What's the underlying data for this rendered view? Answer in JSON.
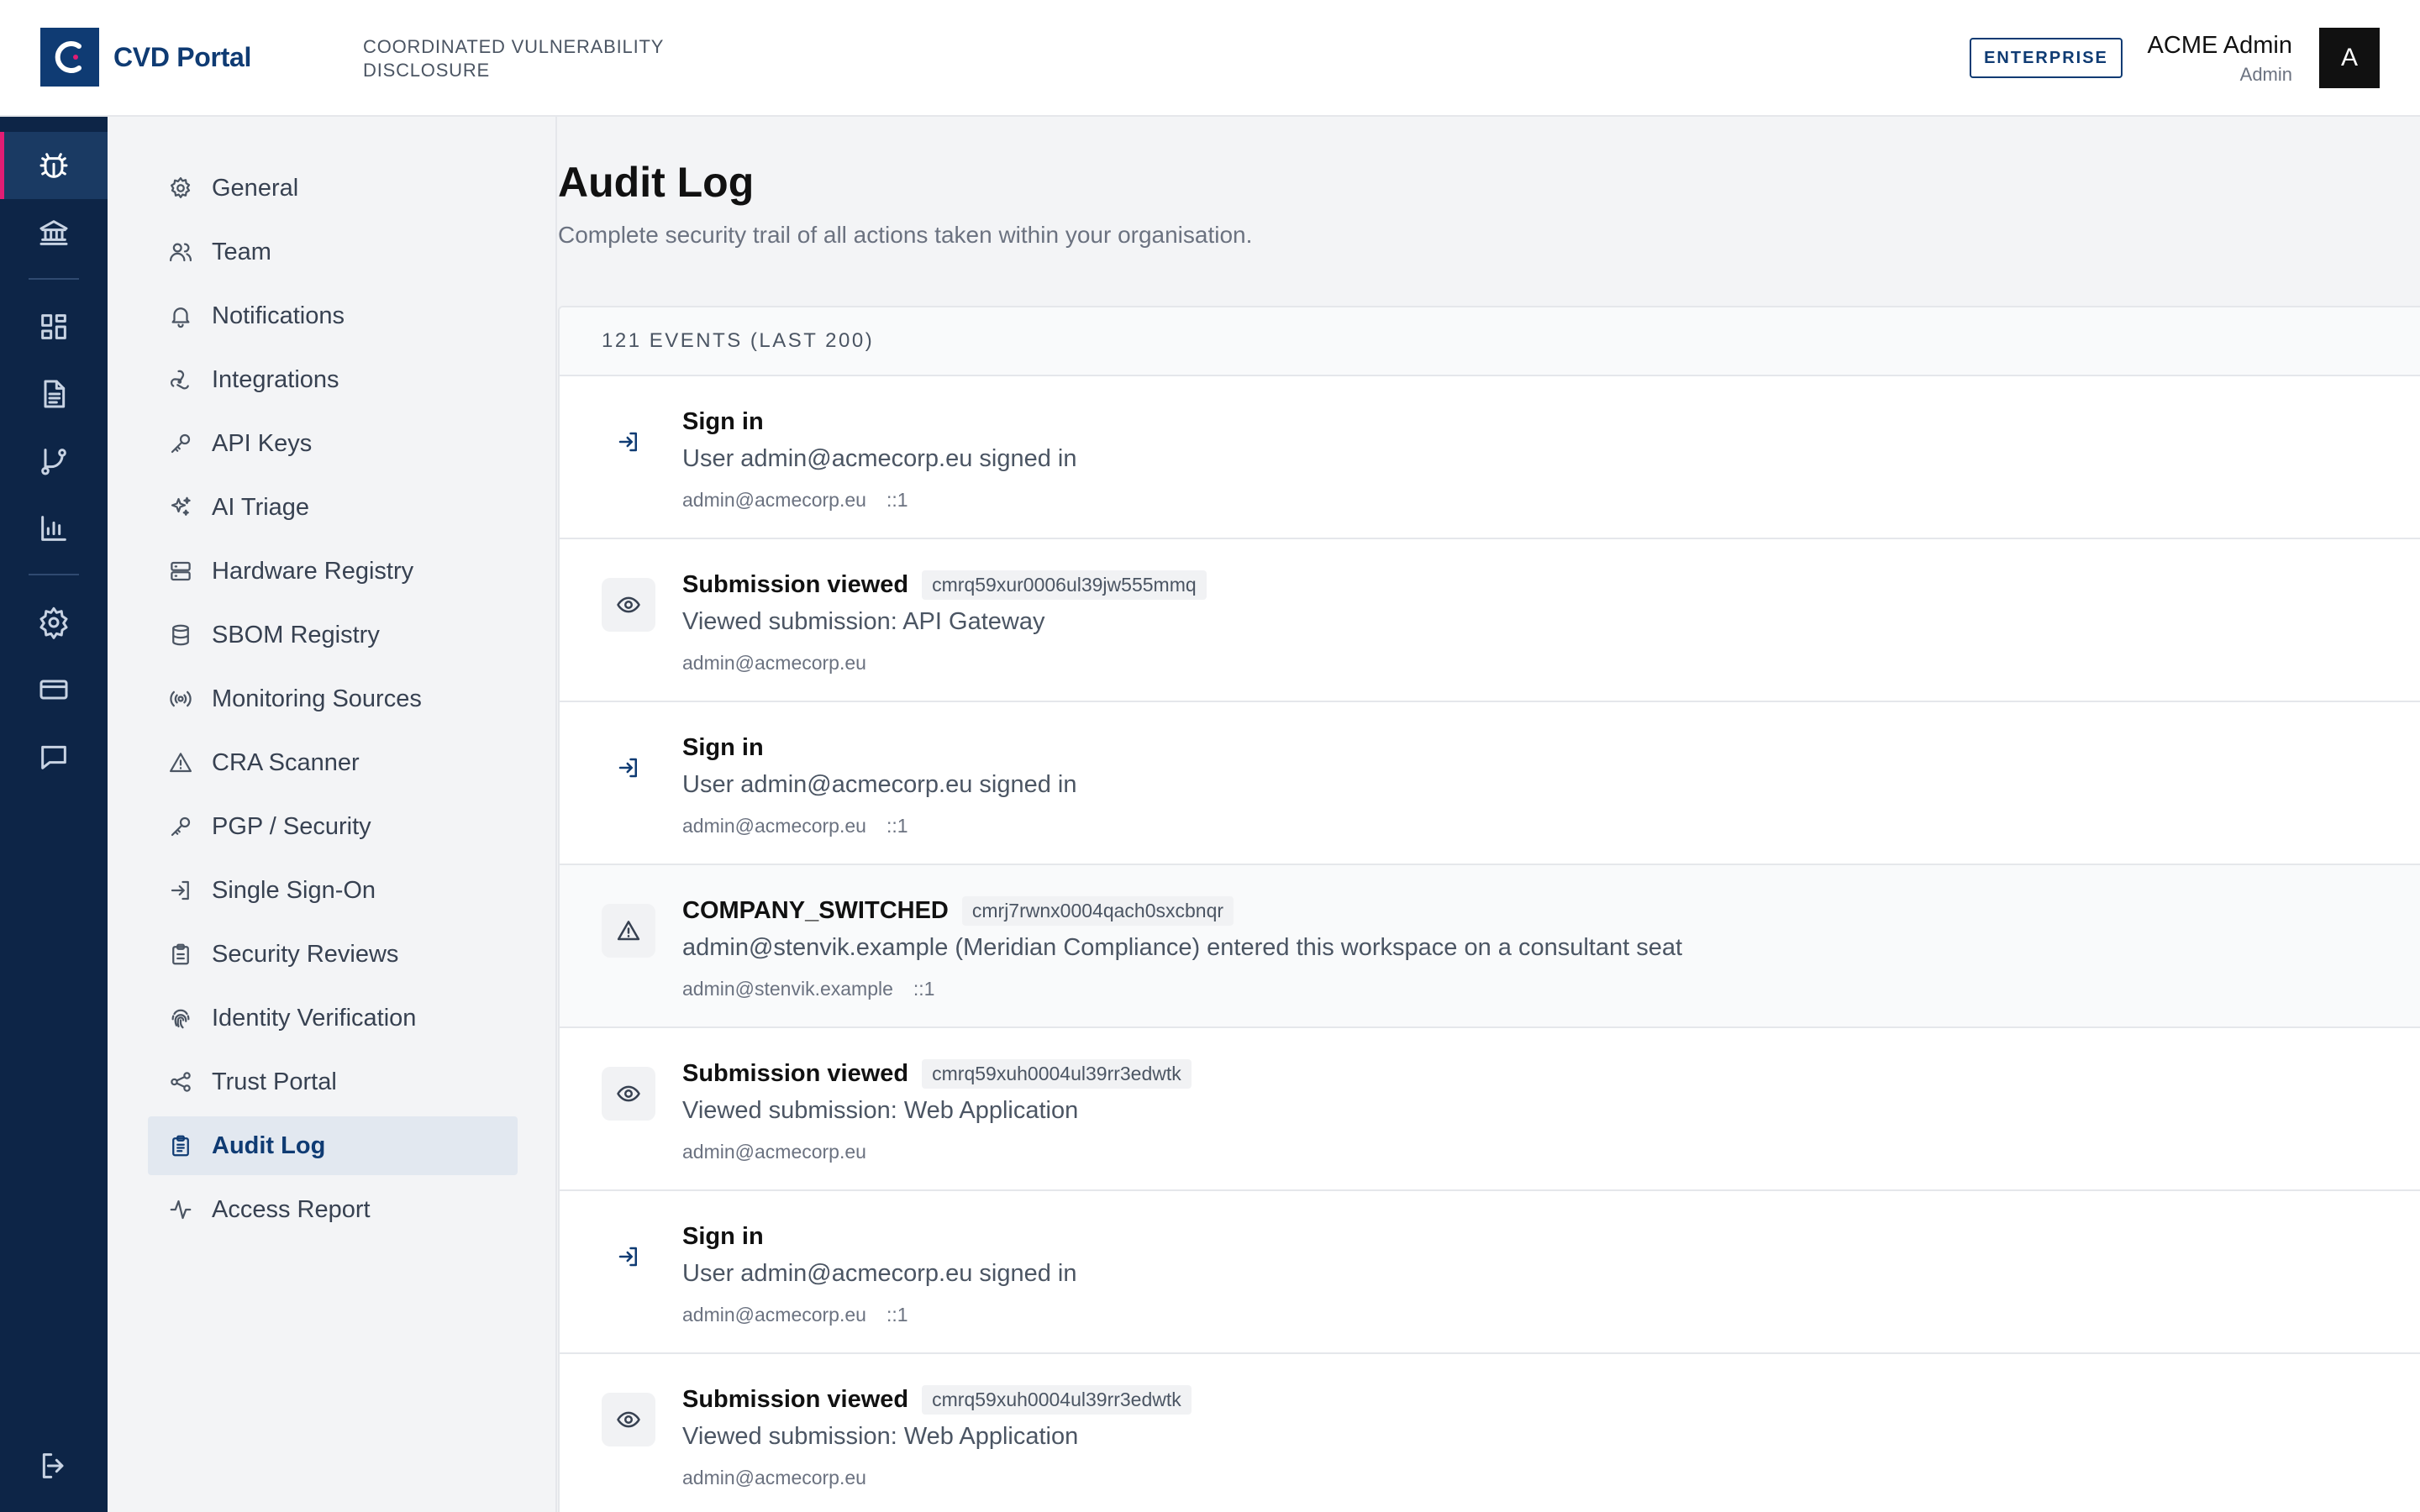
{
  "header": {
    "brand": "CVD Portal",
    "tagline": "COORDINATED VULNERABILITY DISCLOSURE",
    "plan_badge": "ENTERPRISE",
    "user_name": "ACME Admin",
    "user_role": "Admin",
    "avatar_initial": "A"
  },
  "rail": {
    "items": [
      {
        "icon": "bug-icon",
        "active": true
      },
      {
        "icon": "bank-icon"
      },
      {
        "icon": "dashboard-icon"
      },
      {
        "icon": "document-icon"
      },
      {
        "icon": "git-branch-icon"
      },
      {
        "icon": "bar-chart-icon"
      },
      {
        "icon": "gear-icon"
      },
      {
        "icon": "credit-card-icon"
      },
      {
        "icon": "chat-icon"
      },
      {
        "icon": "logout-icon"
      }
    ]
  },
  "settings_nav": {
    "items": [
      {
        "label": "General",
        "icon": "gear-icon"
      },
      {
        "label": "Team",
        "icon": "users-icon"
      },
      {
        "label": "Notifications",
        "icon": "bell-icon"
      },
      {
        "label": "Integrations",
        "icon": "webhook-icon"
      },
      {
        "label": "API Keys",
        "icon": "key-icon"
      },
      {
        "label": "AI Triage",
        "icon": "sparkles-icon"
      },
      {
        "label": "Hardware Registry",
        "icon": "server-icon"
      },
      {
        "label": "SBOM Registry",
        "icon": "database-icon"
      },
      {
        "label": "Monitoring Sources",
        "icon": "radio-icon"
      },
      {
        "label": "CRA Scanner",
        "icon": "warning-icon"
      },
      {
        "label": "PGP / Security",
        "icon": "key-icon"
      },
      {
        "label": "Single Sign-On",
        "icon": "sign-in-icon"
      },
      {
        "label": "Security Reviews",
        "icon": "clipboard-icon"
      },
      {
        "label": "Identity Verification",
        "icon": "fingerprint-icon"
      },
      {
        "label": "Trust Portal",
        "icon": "share-icon"
      },
      {
        "label": "Audit Log",
        "icon": "clipboard-list-icon",
        "active": true
      },
      {
        "label": "Access Report",
        "icon": "activity-icon"
      }
    ]
  },
  "page": {
    "title": "Audit Log",
    "subtitle": "Complete security trail of all actions taken within your organisation."
  },
  "log": {
    "count_label": "121 EVENTS (LAST 200)",
    "events": [
      {
        "type": "signin",
        "title": "Sign in",
        "id": "",
        "description": "User admin@acmecorp.eu signed in",
        "actor": "admin@acmecorp.eu",
        "ip": "::1"
      },
      {
        "type": "view",
        "title": "Submission viewed",
        "id": "cmrq59xur0006ul39jw555mmq",
        "description": "Viewed submission: API Gateway",
        "actor": "admin@acmecorp.eu",
        "ip": ""
      },
      {
        "type": "signin",
        "title": "Sign in",
        "id": "",
        "description": "User admin@acmecorp.eu signed in",
        "actor": "admin@acmecorp.eu",
        "ip": "::1"
      },
      {
        "type": "warning",
        "title": "COMPANY_SWITCHED",
        "id": "cmrj7rwnx0004qach0sxcbnqr",
        "description": "admin@stenvik.example (Meridian Compliance) entered this workspace on a consultant seat",
        "actor": "admin@stenvik.example",
        "ip": "::1"
      },
      {
        "type": "view",
        "title": "Submission viewed",
        "id": "cmrq59xuh0004ul39rr3edwtk",
        "description": "Viewed submission: Web Application",
        "actor": "admin@acmecorp.eu",
        "ip": ""
      },
      {
        "type": "signin",
        "title": "Sign in",
        "id": "",
        "description": "User admin@acmecorp.eu signed in",
        "actor": "admin@acmecorp.eu",
        "ip": "::1"
      },
      {
        "type": "view",
        "title": "Submission viewed",
        "id": "cmrq59xuh0004ul39rr3edwtk",
        "description": "Viewed submission: Web Application",
        "actor": "admin@acmecorp.eu",
        "ip": ""
      }
    ]
  },
  "colors": {
    "brand": "#0f3b73",
    "rail_bg": "#0d2547",
    "accent": "#e11d74"
  }
}
